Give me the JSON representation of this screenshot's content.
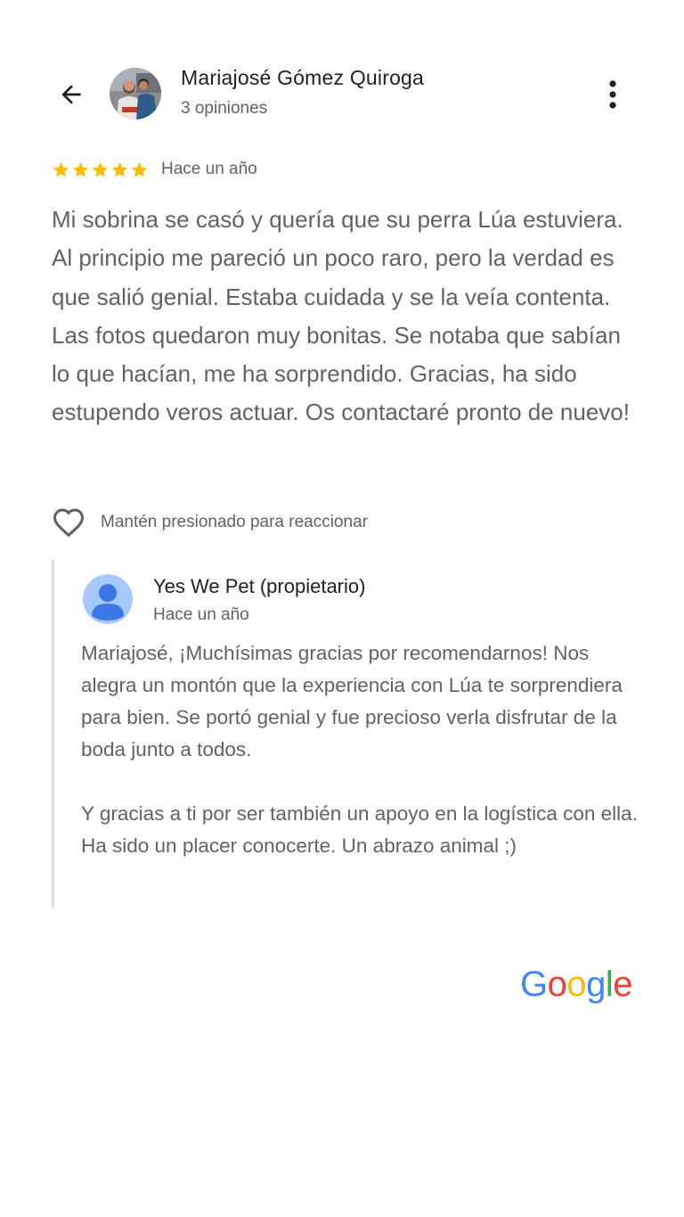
{
  "reviewer": {
    "name": "Mariajosé Gómez Quiroga",
    "reviews_count": "3 opiniones"
  },
  "review": {
    "rating": 5,
    "date": "Hace un año",
    "text": "Mi sobrina se casó y quería que su perra Lúa estuviera. Al principio me pareció un poco raro, pero la verdad es que salió genial. Estaba cuidada y se la veía contenta. Las fotos quedaron muy bonitas. Se notaba que sabían lo que hacían, me ha sorprendido. Gracias, ha sido estupendo veros actuar. Os contactaré pronto de nuevo!"
  },
  "reaction": {
    "hint": "Mantén presionado para reaccionar"
  },
  "owner_reply": {
    "name": "Yes We Pet (propietario)",
    "date": "Hace un año",
    "paragraph1": "Mariajosé, ¡Muchísimas gracias por recomendarnos! Nos alegra un montón que la experiencia con Lúa te sorprendiera para bien. Se portó genial y fue precioso verla disfrutar de la boda junto a todos.",
    "paragraph2": "Y gracias a ti por ser también un apoyo en la logística con ella. Ha sido un placer conocerte. Un abrazo animal ;)"
  },
  "footer": {
    "logo_letters": [
      "G",
      "o",
      "o",
      "g",
      "l",
      "e"
    ]
  },
  "colors": {
    "star": "#fbbc04",
    "text_primary": "#202124",
    "text_secondary": "#5f6368",
    "reply_border": "#dadce0",
    "google_blue": "#4285f4",
    "google_red": "#ea4335",
    "google_yellow": "#fbbc05",
    "google_green": "#34a853"
  },
  "icons": [
    "back-arrow-icon",
    "more-vert-icon",
    "star-icon",
    "heart-outline-icon",
    "default-avatar-icon"
  ]
}
